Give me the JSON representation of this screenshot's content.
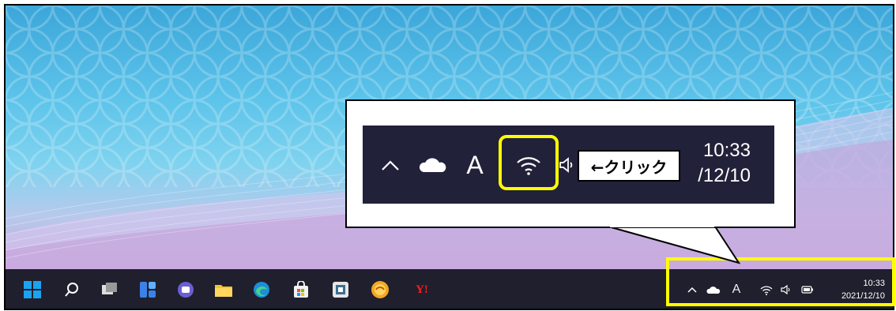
{
  "taskbar": {
    "icons": [
      "windows-start-icon",
      "search-icon",
      "task-view-icon",
      "widgets-icon",
      "teams-chat-icon",
      "file-explorer-icon",
      "edge-icon",
      "store-icon",
      "app-icon",
      "browser-icon",
      "yahoo-icon"
    ],
    "yahoo_label": "Y!"
  },
  "tray": {
    "ime_label": "A",
    "time": "10:33",
    "date": "2021/12/10"
  },
  "callout": {
    "ime_label": "A",
    "time": "10:33",
    "date_partial": "/12/10",
    "instruction": "←クリック"
  },
  "colors": {
    "highlight": "#ffff00",
    "taskbar_bg": "#1f1f2d",
    "zoom_bg": "#22213a"
  }
}
